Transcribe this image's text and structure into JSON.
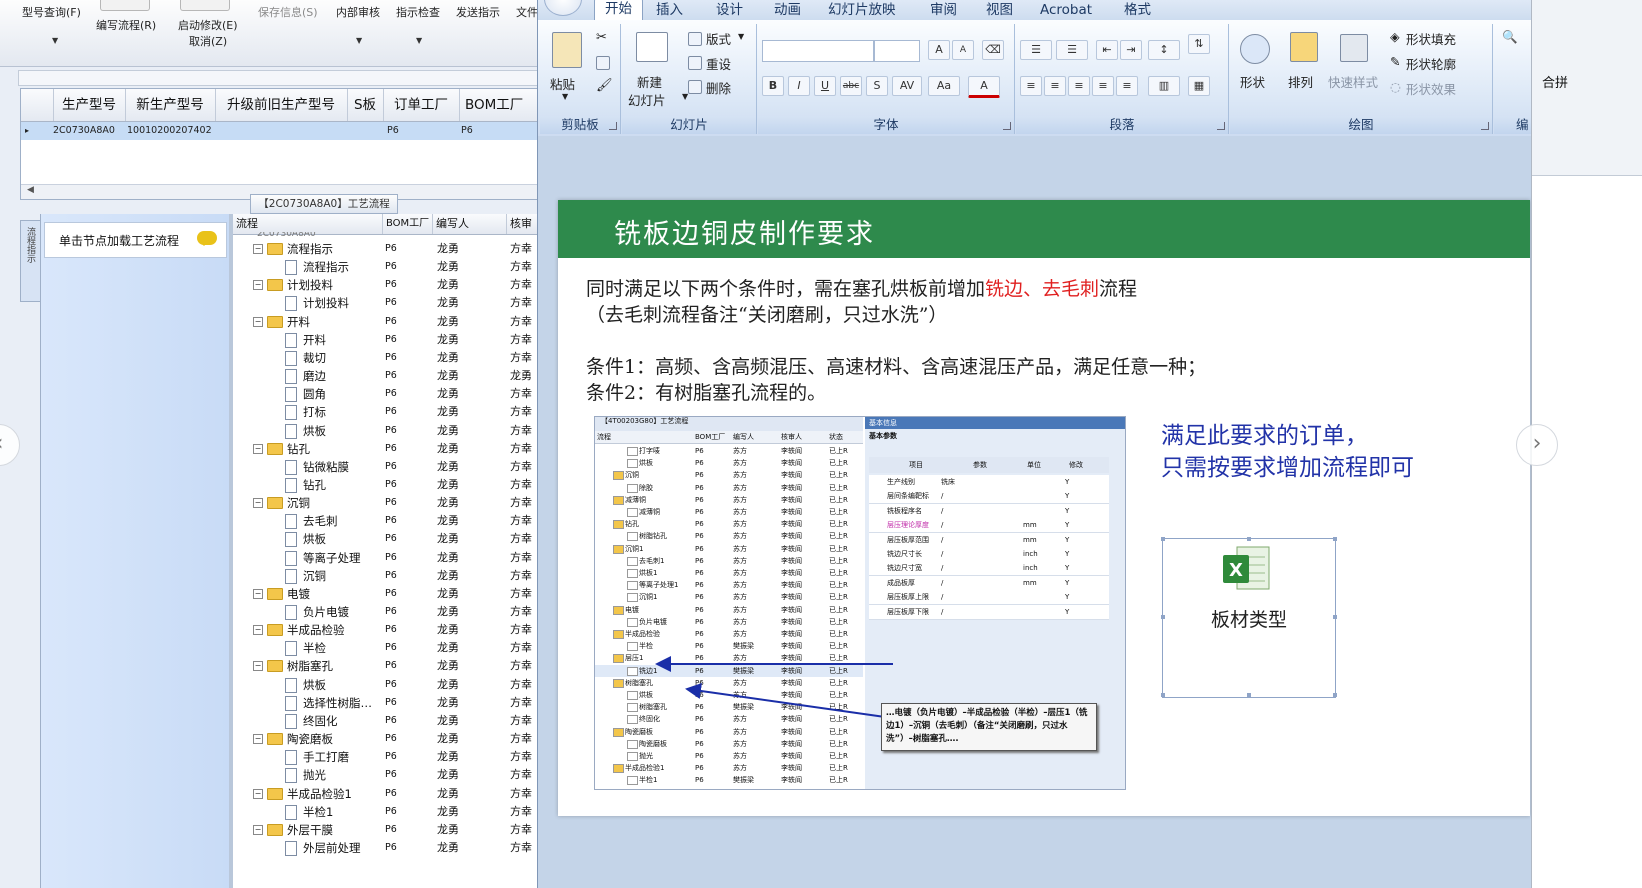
{
  "erp": {
    "toolbar": {
      "items": [
        {
          "label": "型号查询(F)",
          "dim": false
        },
        {
          "label": "编写流程(R)",
          "dim": false
        },
        {
          "label": "启动修改(E)",
          "dim": false
        },
        {
          "label": "取消(Z)",
          "dim": false
        },
        {
          "label": "保存信息(S)",
          "dim": true
        },
        {
          "label": "内部审核",
          "dim": false
        },
        {
          "label": "指示检查",
          "dim": false
        },
        {
          "label": "发送指示",
          "dim": false
        },
        {
          "label": "文件",
          "dim": false
        }
      ]
    },
    "grid": {
      "columns": [
        "生产型号",
        "新生产型号",
        "升级前旧生产型号",
        "S板",
        "订单工厂",
        "BOM工厂"
      ],
      "row": {
        "marker": "▸",
        "model": "2C0730A8A0",
        "new_model": "10010200207402",
        "order_factory": "P6",
        "bom_factory": "P6"
      }
    },
    "section_title": "【2C0730A8A0】工艺流程",
    "side_tab_label": "流程指示",
    "node_hint": "单击节点加载工艺流程",
    "tree": {
      "columns": [
        "流程",
        "BOM工厂",
        "编写人",
        "核审"
      ],
      "top_partial": "2C0730A8A0",
      "rows": [
        {
          "level": 1,
          "name": "流程指示",
          "bom": "P6",
          "author": "龙勇",
          "review": "方幸"
        },
        {
          "level": 2,
          "name": "流程指示",
          "bom": "P6",
          "author": "龙勇",
          "review": "方幸"
        },
        {
          "level": 1,
          "name": "计划投料",
          "bom": "P6",
          "author": "龙勇",
          "review": "方幸"
        },
        {
          "level": 2,
          "name": "计划投料",
          "bom": "P6",
          "author": "龙勇",
          "review": "方幸"
        },
        {
          "level": 1,
          "name": "开料",
          "bom": "P6",
          "author": "龙勇",
          "review": "方幸"
        },
        {
          "level": 2,
          "name": "开料",
          "bom": "P6",
          "author": "龙勇",
          "review": "方幸"
        },
        {
          "level": 2,
          "name": "裁切",
          "bom": "P6",
          "author": "龙勇",
          "review": "方幸"
        },
        {
          "level": 2,
          "name": "磨边",
          "bom": "P6",
          "author": "龙勇",
          "review": "龙勇"
        },
        {
          "level": 2,
          "name": "圆角",
          "bom": "P6",
          "author": "龙勇",
          "review": "方幸"
        },
        {
          "level": 2,
          "name": "打标",
          "bom": "P6",
          "author": "龙勇",
          "review": "方幸"
        },
        {
          "level": 2,
          "name": "烘板",
          "bom": "P6",
          "author": "龙勇",
          "review": "方幸"
        },
        {
          "level": 1,
          "name": "钻孔",
          "bom": "P6",
          "author": "龙勇",
          "review": "方幸"
        },
        {
          "level": 2,
          "name": "钻微粘膜",
          "bom": "P6",
          "author": "龙勇",
          "review": "方幸"
        },
        {
          "level": 2,
          "name": "钻孔",
          "bom": "P6",
          "author": "龙勇",
          "review": "方幸"
        },
        {
          "level": 1,
          "name": "沉铜",
          "bom": "P6",
          "author": "龙勇",
          "review": "方幸"
        },
        {
          "level": 2,
          "name": "去毛刺",
          "bom": "P6",
          "author": "龙勇",
          "review": "方幸"
        },
        {
          "level": 2,
          "name": "烘板",
          "bom": "P6",
          "author": "龙勇",
          "review": "方幸"
        },
        {
          "level": 2,
          "name": "等离子处理",
          "bom": "P6",
          "author": "龙勇",
          "review": "方幸"
        },
        {
          "level": 2,
          "name": "沉铜",
          "bom": "P6",
          "author": "龙勇",
          "review": "方幸"
        },
        {
          "level": 1,
          "name": "电镀",
          "bom": "P6",
          "author": "龙勇",
          "review": "方幸"
        },
        {
          "level": 2,
          "name": "负片电镀",
          "bom": "P6",
          "author": "龙勇",
          "review": "方幸"
        },
        {
          "level": 1,
          "name": "半成品检验",
          "bom": "P6",
          "author": "龙勇",
          "review": "方幸"
        },
        {
          "level": 2,
          "name": "半检",
          "bom": "P6",
          "author": "龙勇",
          "review": "方幸"
        },
        {
          "level": 1,
          "name": "树脂塞孔",
          "bom": "P6",
          "author": "龙勇",
          "review": "方幸"
        },
        {
          "level": 2,
          "name": "烘板",
          "bom": "P6",
          "author": "龙勇",
          "review": "方幸"
        },
        {
          "level": 2,
          "name": "选择性树脂…",
          "bom": "P6",
          "author": "龙勇",
          "review": "方幸"
        },
        {
          "level": 2,
          "name": "终固化",
          "bom": "P6",
          "author": "龙勇",
          "review": "方幸"
        },
        {
          "level": 1,
          "name": "陶瓷磨板",
          "bom": "P6",
          "author": "龙勇",
          "review": "方幸"
        },
        {
          "level": 2,
          "name": "手工打磨",
          "bom": "P6",
          "author": "龙勇",
          "review": "方幸"
        },
        {
          "level": 2,
          "name": "抛光",
          "bom": "P6",
          "author": "龙勇",
          "review": "方幸"
        },
        {
          "level": 1,
          "name": "半成品检验1",
          "bom": "P6",
          "author": "龙勇",
          "review": "方幸"
        },
        {
          "level": 2,
          "name": "半检1",
          "bom": "P6",
          "author": "龙勇",
          "review": "方幸"
        },
        {
          "level": 1,
          "name": "外层干膜",
          "bom": "P6",
          "author": "龙勇",
          "review": "方幸"
        },
        {
          "level": 2,
          "name": "外层前处理",
          "bom": "P6",
          "author": "龙勇",
          "review": "方幸"
        }
      ]
    }
  },
  "ppt": {
    "tabs": [
      {
        "label": "开始",
        "active": true
      },
      {
        "label": "插入",
        "active": false
      },
      {
        "label": "设计",
        "active": false
      },
      {
        "label": "动画",
        "active": false
      },
      {
        "label": "幻灯片放映",
        "active": false
      },
      {
        "label": "审阅",
        "active": false
      },
      {
        "label": "视图",
        "active": false
      },
      {
        "label": "Acrobat",
        "active": false
      },
      {
        "label": "格式",
        "active": false
      }
    ],
    "ribbon": {
      "clipboard": {
        "label": "剪贴板",
        "paste": "粘贴"
      },
      "slides": {
        "label": "幻灯片",
        "new_slide_1": "新建",
        "new_slide_2": "幻灯片",
        "layout": "版式",
        "reset": "重设",
        "delete": "删除"
      },
      "font": {
        "label": "字体",
        "bold": "B",
        "italic": "I",
        "underline": "U",
        "strike": "abc",
        "shadow": "S",
        "spacing": "AV",
        "case": "Aa",
        "color": "A",
        "grow": "A",
        "shrink": "A"
      },
      "paragraph": {
        "label": "段落"
      },
      "drawing": {
        "label": "绘图",
        "shapes": "形状",
        "arrange": "排列",
        "quick_styles": "快速样式",
        "fill": "形状填充",
        "outline": "形状轮廓",
        "effects": "形状效果"
      },
      "edit_partial": "编"
    },
    "slide": {
      "title": "铣板边铜皮制作要求",
      "line1_pre": "同时满足以下两个条件时，需在塞孔烘板前增加",
      "line1_red": "铣边、去毛刺",
      "line1_post": "流程",
      "line2": "（去毛刺流程备注“关闭磨刷，只过水洗”）",
      "cond1": "条件1：高频、含高频混压、高速材料、含高速混压产品，满足任意一种；",
      "cond2": "条件2：有树脂塞孔流程的。",
      "note_line1": "满足此要求的订单，",
      "note_line2": "只需按要求增加流程即可",
      "excel_label": "板材类型",
      "excel_letter": "X",
      "embedded": {
        "title": "【4T00203G80】工艺流程",
        "columns": [
          "流程",
          "BOM工厂",
          "编写人",
          "核审人",
          "状态"
        ],
        "rows": [
          [
            "打字唛",
            "P6",
            "苏方",
            "李轶阎",
            "已上R"
          ],
          [
            "烘板",
            "P6",
            "苏方",
            "李轶阎",
            "已上R"
          ],
          [
            "沉铜",
            "P6",
            "苏方",
            "李轶阎",
            "已上R"
          ],
          [
            "除胶",
            "P6",
            "苏方",
            "李轶阎",
            "已上R"
          ],
          [
            "减薄铜",
            "P6",
            "苏方",
            "李轶阎",
            "已上R"
          ],
          [
            "减薄铜",
            "P6",
            "苏方",
            "李轶阎",
            "已上R"
          ],
          [
            "钻孔",
            "P6",
            "苏方",
            "李轶阎",
            "已上R"
          ],
          [
            "树脂钻孔",
            "P6",
            "苏方",
            "李轶阎",
            "已上R"
          ],
          [
            "沉铜1",
            "P6",
            "苏方",
            "李轶阎",
            "已上R"
          ],
          [
            "去毛刺1",
            "P6",
            "苏方",
            "李轶阎",
            "已上R"
          ],
          [
            "烘板1",
            "P6",
            "苏方",
            "李轶阎",
            "已上R"
          ],
          [
            "等离子处理1",
            "P6",
            "苏方",
            "李轶阎",
            "已上R"
          ],
          [
            "沉铜1",
            "P6",
            "苏方",
            "李轶阎",
            "已上R"
          ],
          [
            "电镀",
            "P6",
            "苏方",
            "李轶阎",
            "已上R"
          ],
          [
            "负片电镀",
            "P6",
            "苏方",
            "李轶阎",
            "已上R"
          ],
          [
            "半成品检验",
            "P6",
            "苏方",
            "李轶阎",
            "已上R"
          ],
          [
            "半检",
            "P6",
            "樊振梁",
            "李轶阎",
            "已上R"
          ],
          [
            "层压1",
            "P6",
            "苏方",
            "李轶阎",
            "已上R"
          ],
          [
            "铣边1",
            "P6",
            "樊振梁",
            "李轶阎",
            "已上R"
          ],
          [
            "树脂塞孔",
            "P6",
            "苏方",
            "李轶阎",
            "已上R"
          ],
          [
            "烘板",
            "P6",
            "苏方",
            "李轶阎",
            "已上R"
          ],
          [
            "树脂塞孔",
            "P6",
            "樊振梁",
            "李轶阎",
            "已上R"
          ],
          [
            "终固化",
            "P6",
            "苏方",
            "李轶阎",
            "已上R"
          ],
          [
            "陶瓷磨板",
            "P6",
            "苏方",
            "李轶阎",
            "已上R"
          ],
          [
            "陶瓷磨板",
            "P6",
            "苏方",
            "李轶阎",
            "已上R"
          ],
          [
            "抛光",
            "P6",
            "苏方",
            "李轶阎",
            "已上R"
          ],
          [
            "半成品检验1",
            "P6",
            "苏方",
            "李轶阎",
            "已上R"
          ],
          [
            "半检1",
            "P6",
            "樊振梁",
            "李轶阎",
            "已上R"
          ]
        ],
        "right_header": "基本信息",
        "right_subheader": "基本参数",
        "right_columns": [
          "项目",
          "参数",
          "单位",
          "修改"
        ],
        "right_rows": [
          [
            "生产线别",
            "铣床",
            "",
            "Y"
          ],
          [
            "层间条编靶标",
            "/",
            "",
            "Y"
          ],
          [
            "铣板程序名",
            "/",
            "",
            "Y"
          ],
          [
            "层压理论厚度",
            "/",
            "mm",
            "Y"
          ],
          [
            "层压板厚范围",
            "/",
            "mm",
            "Y"
          ],
          [
            "铣边尺寸长",
            "/",
            "inch",
            "Y"
          ],
          [
            "铣边尺寸宽",
            "/",
            "inch",
            "Y"
          ],
          [
            "成品板厚",
            "/",
            "mm",
            "Y"
          ],
          [
            "层压板厚上限",
            "/",
            "",
            "Y"
          ],
          [
            "层压板厚下限",
            "/",
            "",
            "Y"
          ]
        ],
        "callout": "…电镀（负片电镀）–半成品检验（半检）–层压1（铣边1）–沉铜（去毛刺）（备注“关闭磨刷，只过水洗”）–树脂塞孔…."
      }
    }
  },
  "right_strip": {
    "label": "合拼"
  },
  "nav": {
    "prev": "‹",
    "next": "›"
  }
}
